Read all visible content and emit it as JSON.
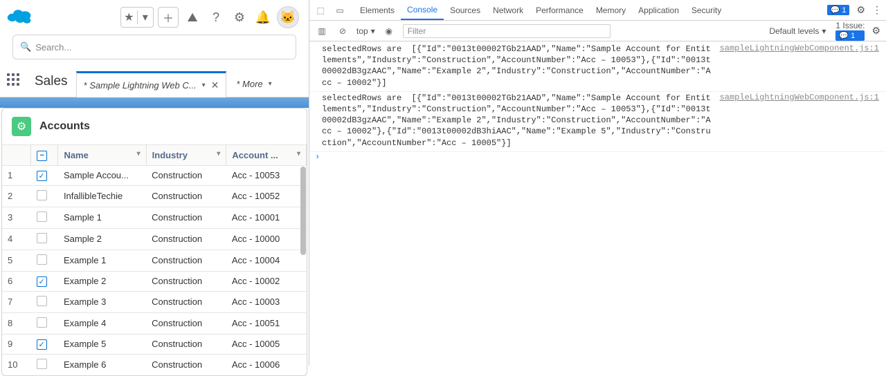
{
  "header": {
    "search_placeholder": "Search...",
    "app_name": "Sales",
    "tab_active": "* Sample Lightning Web C...",
    "tab_more": "* More"
  },
  "card": {
    "title": "Accounts",
    "columns": {
      "name": "Name",
      "industry": "Industry",
      "account": "Account ..."
    },
    "rows": [
      {
        "n": "1",
        "checked": true,
        "name": "Sample Accou...",
        "industry": "Construction",
        "acc": "Acc - 10053"
      },
      {
        "n": "2",
        "checked": false,
        "name": "InfallibleTechie",
        "industry": "Construction",
        "acc": "Acc - 10052"
      },
      {
        "n": "3",
        "checked": false,
        "name": "Sample 1",
        "industry": "Construction",
        "acc": "Acc - 10001"
      },
      {
        "n": "4",
        "checked": false,
        "name": "Sample 2",
        "industry": "Construction",
        "acc": "Acc - 10000"
      },
      {
        "n": "5",
        "checked": false,
        "name": "Example 1",
        "industry": "Construction",
        "acc": "Acc - 10004"
      },
      {
        "n": "6",
        "checked": true,
        "name": "Example 2",
        "industry": "Construction",
        "acc": "Acc - 10002"
      },
      {
        "n": "7",
        "checked": false,
        "name": "Example 3",
        "industry": "Construction",
        "acc": "Acc - 10003"
      },
      {
        "n": "8",
        "checked": false,
        "name": "Example 4",
        "industry": "Construction",
        "acc": "Acc - 10051"
      },
      {
        "n": "9",
        "checked": true,
        "name": "Example 5",
        "industry": "Construction",
        "acc": "Acc - 10005"
      },
      {
        "n": "10",
        "checked": false,
        "name": "Example 6",
        "industry": "Construction",
        "acc": "Acc - 10006"
      }
    ]
  },
  "devtools": {
    "tabs": [
      "Elements",
      "Console",
      "Sources",
      "Network",
      "Performance",
      "Memory",
      "Application",
      "Security"
    ],
    "active_tab": "Console",
    "badge_count": "1",
    "issue_label": "1 Issue:",
    "issue_count": "1",
    "context": "top",
    "filter_placeholder": "Filter",
    "levels": "Default levels",
    "logs": [
      {
        "msg": "selectedRows are  [{\"Id\":\"0013t00002TGb21AAD\",\"Name\":\"Sample Account for Entitlements\",\"Industry\":\"Construction\",\"AccountNumber\":\"Acc – 10053\"},{\"Id\":\"0013t00002dB3gzAAC\",\"Name\":\"Example 2\",\"Industry\":\"Construction\",\"AccountNumber\":\"Acc – 10002\"}]",
        "src": "sampleLightningWebComponent.js:1"
      },
      {
        "msg": "selectedRows are  [{\"Id\":\"0013t00002TGb21AAD\",\"Name\":\"Sample Account for Entitlements\",\"Industry\":\"Construction\",\"AccountNumber\":\"Acc – 10053\"},{\"Id\":\"0013t00002dB3gzAAC\",\"Name\":\"Example 2\",\"Industry\":\"Construction\",\"AccountNumber\":\"Acc – 10002\"},{\"Id\":\"0013t00002dB3hiAAC\",\"Name\":\"Example 5\",\"Industry\":\"Construction\",\"AccountNumber\":\"Acc – 10005\"}]",
        "src": "sampleLightningWebComponent.js:1"
      }
    ]
  }
}
